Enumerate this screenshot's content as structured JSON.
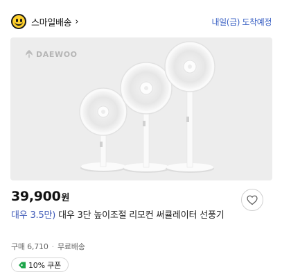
{
  "header": {
    "smile_delivery_label": "스마일배송",
    "chevron": "›",
    "delivery_eta": "내일(금) 도착예정"
  },
  "product": {
    "brand_logo_text": "DAEWOO",
    "price": "39,900",
    "currency": "원",
    "title_brand": "대우 3.5만)",
    "title_rest": " 대우 3단 높이조절 리모컨 써큘레이터 선풍기",
    "purchase_count": "구매 6,710",
    "separator": "·",
    "shipping": "무료배송",
    "coupon": "10% 쿠폰"
  },
  "colors": {
    "accent_blue": "#3a61c4",
    "coupon_green": "#1fa64b",
    "smile_yellow": "#ffd12e"
  },
  "icons": {
    "smile": "smile-delivery-icon",
    "wish": "heart-outline-icon",
    "coupon": "coupon-tag-icon"
  }
}
